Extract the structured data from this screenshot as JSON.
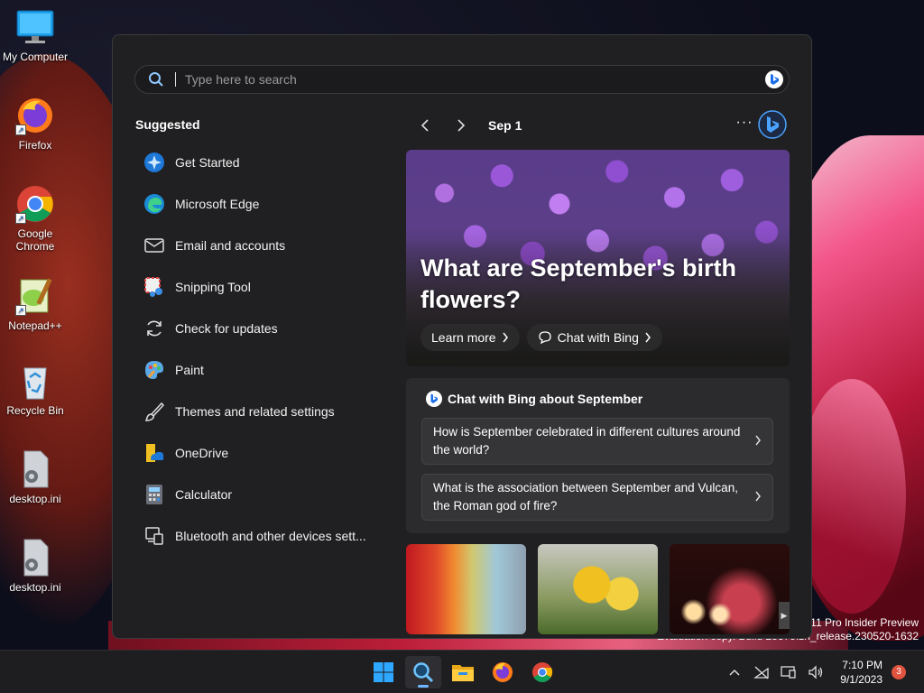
{
  "desktop": {
    "icons": [
      {
        "label": "My Computer",
        "icon": "computer-icon"
      },
      {
        "label": "Firefox",
        "icon": "firefox-icon"
      },
      {
        "label": "Google Chrome",
        "icon": "chrome-icon"
      },
      {
        "label": "Notepad++",
        "icon": "notepadpp-icon"
      },
      {
        "label": "Recycle Bin",
        "icon": "recycle-bin-icon"
      },
      {
        "label": "desktop.ini",
        "icon": "settings-file-icon"
      },
      {
        "label": "desktop.ini",
        "icon": "settings-file-icon"
      }
    ]
  },
  "search": {
    "placeholder": "Type here to search"
  },
  "suggested": {
    "title": "Suggested",
    "items": [
      {
        "label": "Get Started",
        "icon": "get-started-icon"
      },
      {
        "label": "Microsoft Edge",
        "icon": "edge-icon"
      },
      {
        "label": "Email and accounts",
        "icon": "mail-icon"
      },
      {
        "label": "Snipping Tool",
        "icon": "snipping-tool-icon"
      },
      {
        "label": "Check for updates",
        "icon": "refresh-icon"
      },
      {
        "label": "Paint",
        "icon": "paint-icon"
      },
      {
        "label": "Themes and related settings",
        "icon": "brush-icon"
      },
      {
        "label": "OneDrive",
        "icon": "onedrive-icon"
      },
      {
        "label": "Calculator",
        "icon": "calculator-icon"
      },
      {
        "label": "Bluetooth and other devices sett...",
        "icon": "devices-icon"
      }
    ]
  },
  "highlights": {
    "date": "Sep 1",
    "more": "···",
    "hero": {
      "title": "What are September's birth flowers?",
      "learn_more": "Learn more",
      "chat_with_bing": "Chat with Bing"
    },
    "chat_card": {
      "title": "Chat with Bing about September",
      "questions": [
        "How is September celebrated in different cultures around the world?",
        "What is the association between September and Vulcan, the Roman god of fire?"
      ]
    }
  },
  "watermark": {
    "line1": "s 11 Pro Insider Preview",
    "line2": "Evaluation copy. Build 25375.zn_release.230520-1632"
  },
  "taskbar": {
    "apps": [
      {
        "icon": "windows-start-icon"
      },
      {
        "icon": "search-icon",
        "active": true
      },
      {
        "icon": "file-explorer-icon"
      },
      {
        "icon": "firefox-icon"
      },
      {
        "icon": "chrome-icon"
      }
    ],
    "time": "7:10 PM",
    "date": "9/1/2023",
    "notification_count": "3"
  },
  "colors": {
    "accent": "#4aa3ff",
    "panel_bg": "#202022",
    "badge": "#e0533e"
  }
}
